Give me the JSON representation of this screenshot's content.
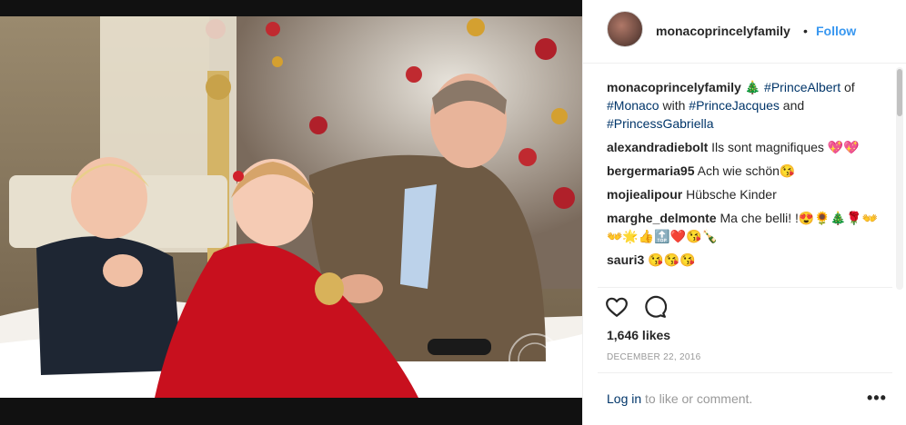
{
  "post": {
    "username": "monacoprincelyfamily",
    "follow_separator": "•",
    "follow_label": "Follow",
    "photo_alt": "Prince Albert of Monaco with Prince Jacques and Princess Gabriella in front of a Christmas tree",
    "caption": {
      "username": "monacoprincelyfamily",
      "emoji": "🎄",
      "tag1": "#PrinceAlbert",
      "of": "of",
      "tag2": "#Monaco",
      "with": "with",
      "tag3": "#PrinceJacques",
      "and": "and",
      "tag4": "#PrincessGabriella"
    },
    "comments": [
      {
        "user": "alexandradiebolt",
        "text": "Ils sont magnifiques 💖💖"
      },
      {
        "user": "bergermaria95",
        "text": "Ach wie schön😘"
      },
      {
        "user": "mojiealipour",
        "text": "Hübsche Kinder"
      },
      {
        "user": "marghe_delmonte",
        "text": "Ma che belli! !😍🌻🎄🌹👐👐🌟👍🔝❤️😘🍾"
      },
      {
        "user": "sauri3",
        "text": "😘😘😘"
      }
    ],
    "likes": "1,646 likes",
    "date": "DECEMBER 22, 2016",
    "login_link": "Log in",
    "login_rest": " to like or comment.",
    "more_label": "•••"
  },
  "colors": {
    "link_blue": "#3897f0",
    "hashtag": "#003569",
    "muted": "#999999"
  }
}
